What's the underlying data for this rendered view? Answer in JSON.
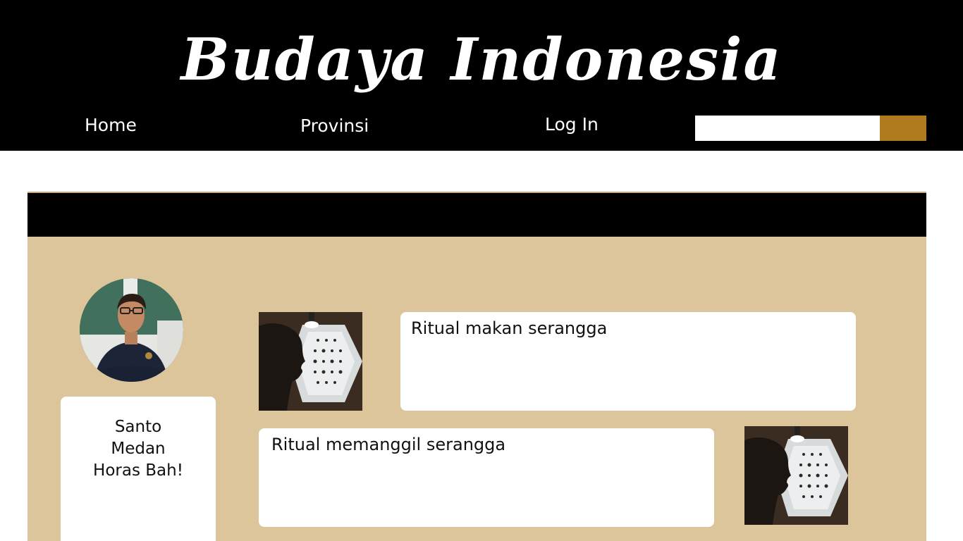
{
  "header": {
    "title": "Budaya Indonesia",
    "nav": {
      "home": "Home",
      "provinsi": "Provinsi",
      "login": "Log In"
    },
    "search": {
      "placeholder": "",
      "value": ""
    }
  },
  "colors": {
    "header_bg": "#000000",
    "panel_bg": "#dcc59b",
    "search_button": "#b07a1e",
    "card_bg": "#ffffff"
  },
  "profile": {
    "lines": [
      "Santo",
      "Medan",
      "Horas Bah!"
    ]
  },
  "posts": [
    {
      "title": "Ritual makan serangga"
    },
    {
      "title": "Ritual memanggil serangga"
    }
  ]
}
